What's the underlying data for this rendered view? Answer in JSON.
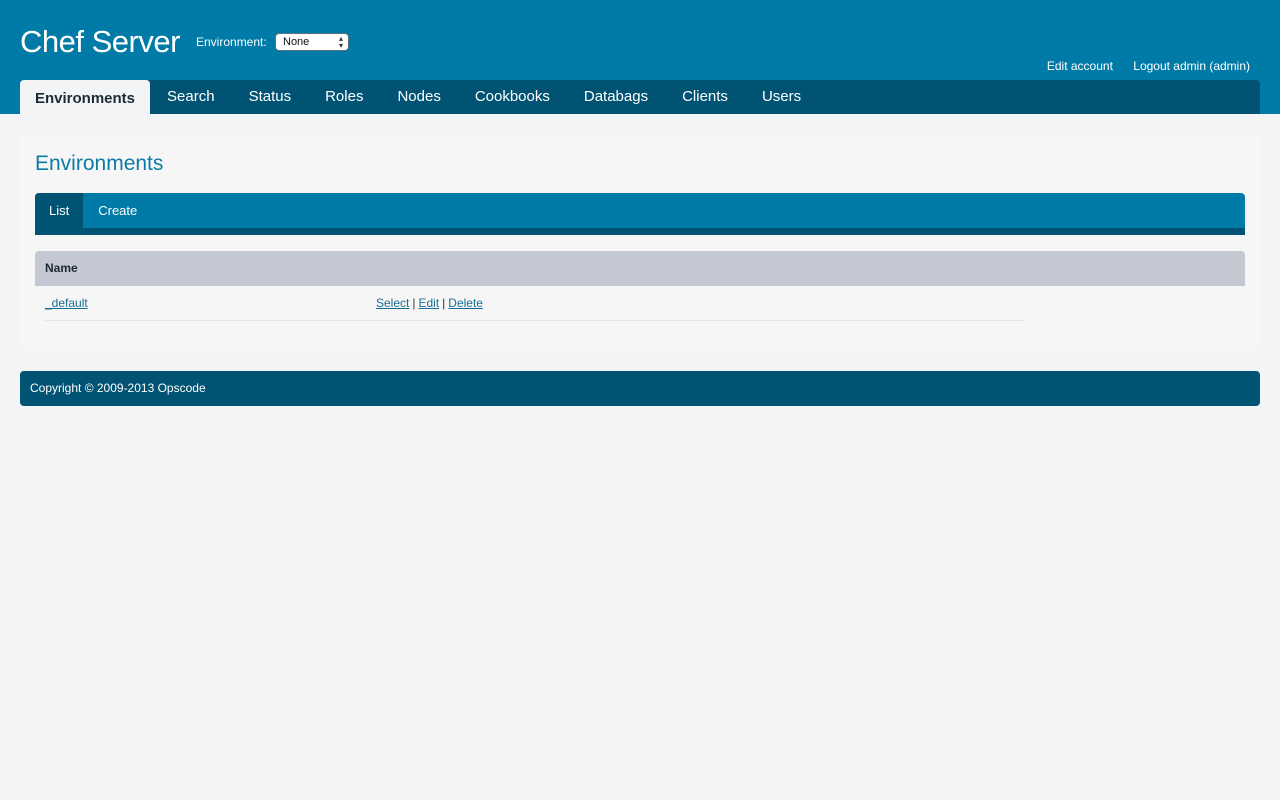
{
  "header": {
    "title": "Chef Server",
    "environment_label": "Environment:",
    "environment_selected": "None",
    "edit_account": "Edit account",
    "logout": "Logout admin (admin)"
  },
  "nav": {
    "tabs": [
      {
        "label": "Environments",
        "active": true
      },
      {
        "label": "Search"
      },
      {
        "label": "Status"
      },
      {
        "label": "Roles"
      },
      {
        "label": "Nodes"
      },
      {
        "label": "Cookbooks"
      },
      {
        "label": "Databags"
      },
      {
        "label": "Clients"
      },
      {
        "label": "Users"
      }
    ]
  },
  "page": {
    "title": "Environments",
    "subtabs": [
      {
        "label": "List",
        "active": true
      },
      {
        "label": "Create"
      }
    ],
    "table": {
      "columns": [
        "Name"
      ],
      "rows": [
        {
          "name": "_default",
          "actions": [
            "Select",
            "Edit",
            "Delete"
          ]
        }
      ]
    }
  },
  "footer": {
    "text": "Copyright © 2009-2013 Opscode"
  },
  "colors": {
    "header_bg": "#007ba8",
    "nav_bg": "#005373",
    "page_bg": "#f3f4f6",
    "link": "#1a6e93",
    "table_header_bg": "#c3c8d2"
  }
}
